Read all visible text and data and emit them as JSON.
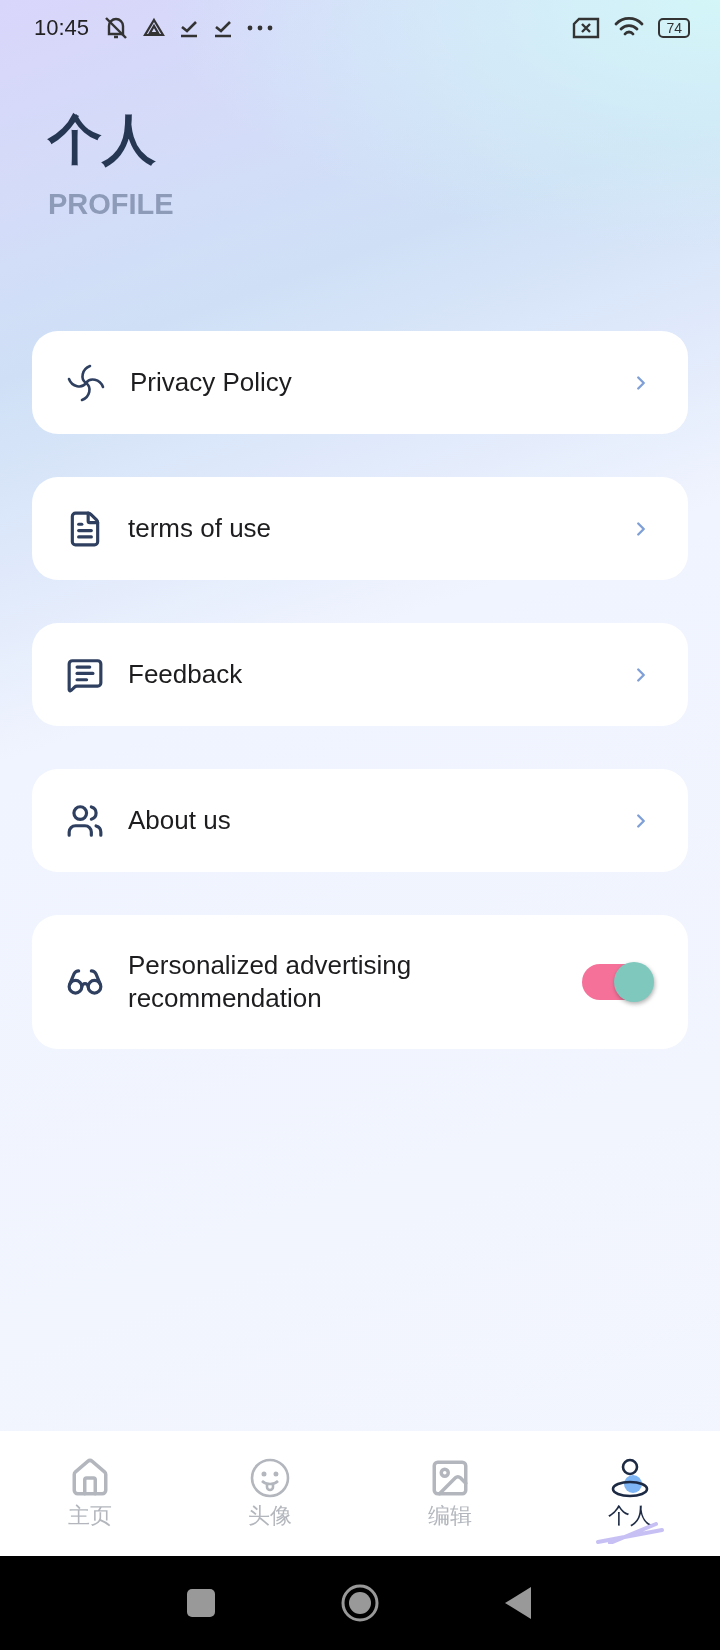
{
  "status_bar": {
    "time": "10:45",
    "battery": "74"
  },
  "header": {
    "title": "个人",
    "subtitle": "PROFILE"
  },
  "menu": [
    {
      "kind": "link",
      "label": "Privacy Policy"
    },
    {
      "kind": "link",
      "label": "terms of use"
    },
    {
      "kind": "link",
      "label": "Feedback"
    },
    {
      "kind": "link",
      "label": "About us"
    },
    {
      "kind": "toggle",
      "label": "Personalized advertising recommendation",
      "on": true
    }
  ],
  "bottom_nav": [
    {
      "label": "主页",
      "selected": false
    },
    {
      "label": "头像",
      "selected": false
    },
    {
      "label": "编辑",
      "selected": false
    },
    {
      "label": "个人",
      "selected": true
    }
  ]
}
